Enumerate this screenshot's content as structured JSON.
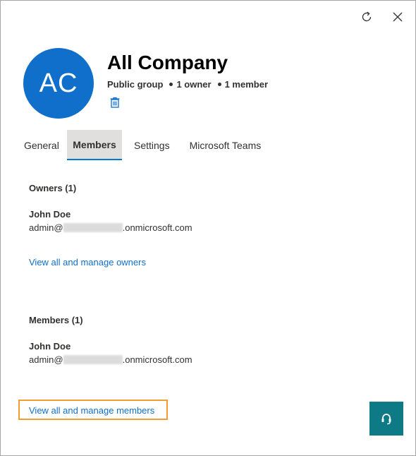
{
  "header": {
    "avatar_initials": "AC",
    "title": "All Company",
    "group_type": "Public group",
    "owner_count": "1 owner",
    "member_count": "1 member"
  },
  "tabs": [
    {
      "label": "General"
    },
    {
      "label": "Members"
    },
    {
      "label": "Settings"
    },
    {
      "label": "Microsoft Teams"
    }
  ],
  "active_tab": "Members",
  "owners": {
    "title": "Owners (1)",
    "name": "John Doe",
    "email_prefix": "admin@",
    "email_suffix": ".onmicrosoft.com",
    "link": "View all and manage owners"
  },
  "members": {
    "title": "Members (1)",
    "name": "John Doe",
    "email_prefix": "admin@",
    "email_suffix": ".onmicrosoft.com",
    "link": "View all and manage members"
  },
  "icons": {
    "refresh": "refresh-icon",
    "close": "close-icon",
    "delete": "trash-icon",
    "help": "help-agent-icon"
  },
  "colors": {
    "accent": "#0f6fca",
    "avatar": "#0f6fca",
    "highlight": "#f39c34",
    "help_button": "#0e7a85",
    "active_tab_bg": "#e1dfdd"
  }
}
